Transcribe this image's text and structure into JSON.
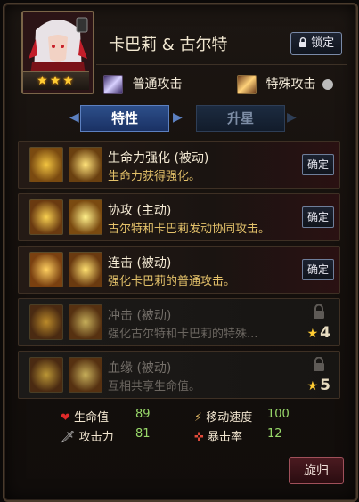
{
  "hero": {
    "name": "卡巴莉 & 古尔特",
    "stars": "★★★"
  },
  "header": {
    "lock_label": "锁定",
    "lock_icon": "lock-icon"
  },
  "attacks": {
    "normal_label": "普通攻击",
    "special_label": "特殊攻击"
  },
  "tabs": [
    {
      "label": "特性",
      "active": true
    },
    {
      "label": "升星",
      "active": false
    }
  ],
  "skills": [
    {
      "name": "生命力强化 (被动)",
      "desc": "生命力获得强化。",
      "action": "确定",
      "locked": false
    },
    {
      "name": "协攻 (主动)",
      "desc": "古尔特和卡巴莉发动协同攻击。",
      "action": "确定",
      "locked": false
    },
    {
      "name": "连击 (被动)",
      "desc": "强化卡巴莉的普通攻击。",
      "action": "确定",
      "locked": false
    },
    {
      "name": "冲击 (被动)",
      "desc": "强化古尔特和卡巴莉的特殊...",
      "required_stars": "4",
      "locked": true
    },
    {
      "name": "血缘 (被动)",
      "desc": "互相共享生命值。",
      "required_stars": "5",
      "locked": true
    }
  ],
  "stats": {
    "hp_label": "生命值",
    "hp_value": "89",
    "atk_label": "攻击力",
    "atk_value": "81",
    "speed_label": "移动速度",
    "speed_value": "100",
    "crit_label": "暴击率",
    "crit_value": "12"
  },
  "footer": {
    "back_label": "旋归"
  },
  "colors": {
    "accent_gold": "#e3c16a",
    "stat_value_green": "#98d86a",
    "tab_active_blue": "#2d4f8a",
    "back_button_red": "#4a1a20"
  }
}
